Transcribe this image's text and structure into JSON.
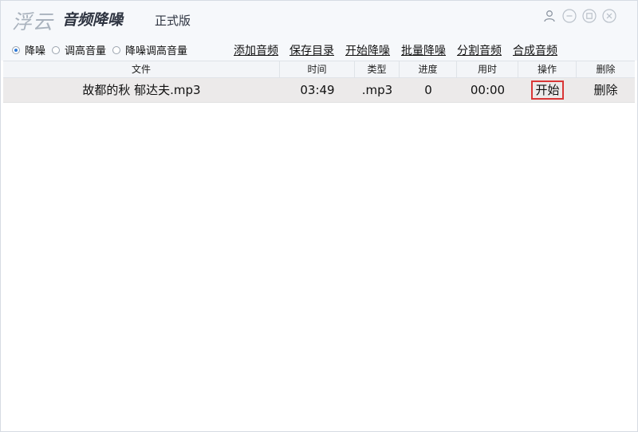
{
  "titlebar": {
    "logo": "浮云",
    "app_name": "音频降噪",
    "edition": "正式版",
    "icons": [
      "user-icon",
      "minimize-icon",
      "maximize-icon",
      "close-icon"
    ]
  },
  "toolbar": {
    "radios": [
      {
        "label": "降噪",
        "selected": true
      },
      {
        "label": "调高音量",
        "selected": false
      },
      {
        "label": "降噪调高音量",
        "selected": false
      }
    ],
    "actions": [
      "添加音频",
      "保存目录",
      "开始降噪",
      "批量降噪",
      "分割音频",
      "合成音频"
    ]
  },
  "table": {
    "headers": [
      "文件",
      "时间",
      "类型",
      "进度",
      "用时",
      "操作",
      "删除"
    ],
    "rows": [
      {
        "file": "故都的秋 郁达夫.mp3",
        "time": "03:49",
        "type": ".mp3",
        "progress": "0",
        "used": "00:00",
        "op": "开始",
        "del": "删除"
      }
    ]
  },
  "colors": {
    "accent": "#2f7ad8",
    "start_outline": "#d93636",
    "row_bg": "#eceaea",
    "header_bg": "#f6f8fb"
  }
}
